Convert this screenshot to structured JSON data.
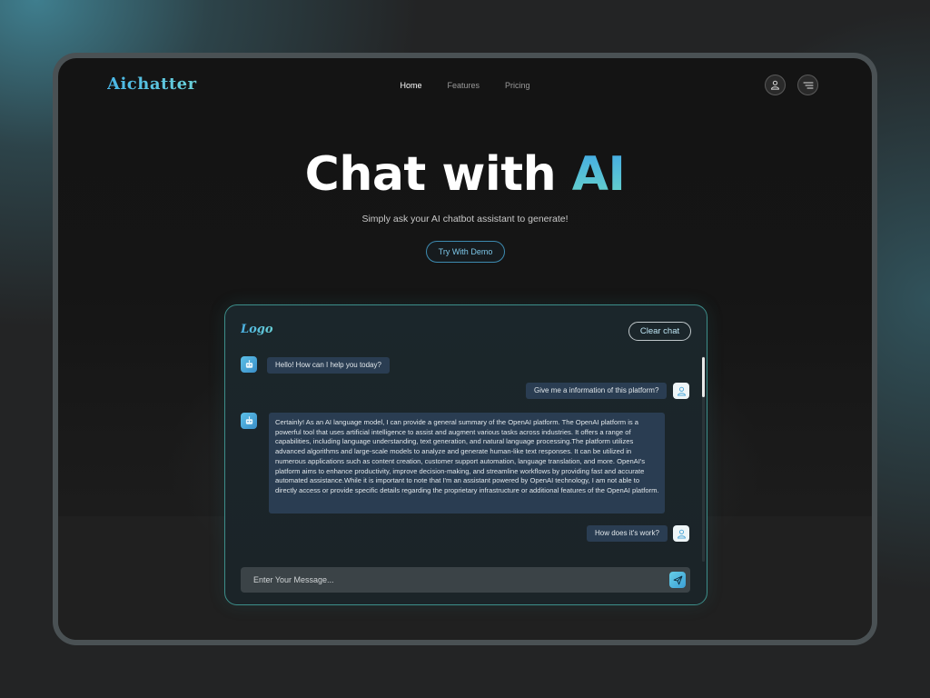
{
  "brand": {
    "name": "Aichatter",
    "color_from": "#49b6e6",
    "color_to": "#6ad0d8"
  },
  "nav": {
    "items": [
      {
        "label": "Home",
        "active": true
      },
      {
        "label": "Features"
      },
      {
        "label": "Pricing"
      }
    ]
  },
  "header_actions": {
    "user_icon": "user-icon",
    "menu_icon": "menu-icon"
  },
  "hero": {
    "title_plain": "Chat with ",
    "title_accent": "AI",
    "subtitle": "Simply ask your AI chatbot assistant to generate!",
    "cta_label": "Try With Demo"
  },
  "chat": {
    "logo": "Logo",
    "clear_label": "Clear chat",
    "messages": [
      {
        "role": "bot",
        "text": "Hello! How can I help you today?"
      },
      {
        "role": "user",
        "text": "Give me a information of this platform?"
      },
      {
        "role": "bot",
        "text": "Certainly! As an AI language model, I can provide a general summary of the OpenAI platform. The OpenAI platform is a powerful tool that uses artificial intelligence to assist and augment various tasks across industries. It offers a range of capabilities, including language understanding, text generation, and natural language processing.The platform utilizes advanced algorithms and large-scale models to analyze and generate human-like text responses. It can be utilized in numerous applications such as content creation, customer support automation, language translation, and more. OpenAI's platform aims to enhance productivity, improve decision-making, and streamline workflows by providing fast and accurate automated assistance.While it is important to note that I'm an assistant powered by OpenAI technology, I am not able to directly access or provide specific details regarding the proprietary infrastructure or additional features of the OpenAI platform."
      },
      {
        "role": "user",
        "text": "How does it's work?"
      }
    ],
    "input_placeholder": "Enter Your Message...",
    "send_icon": "send-icon",
    "accent": "#3d8e8a",
    "bubble_color": "#2a3d52"
  }
}
